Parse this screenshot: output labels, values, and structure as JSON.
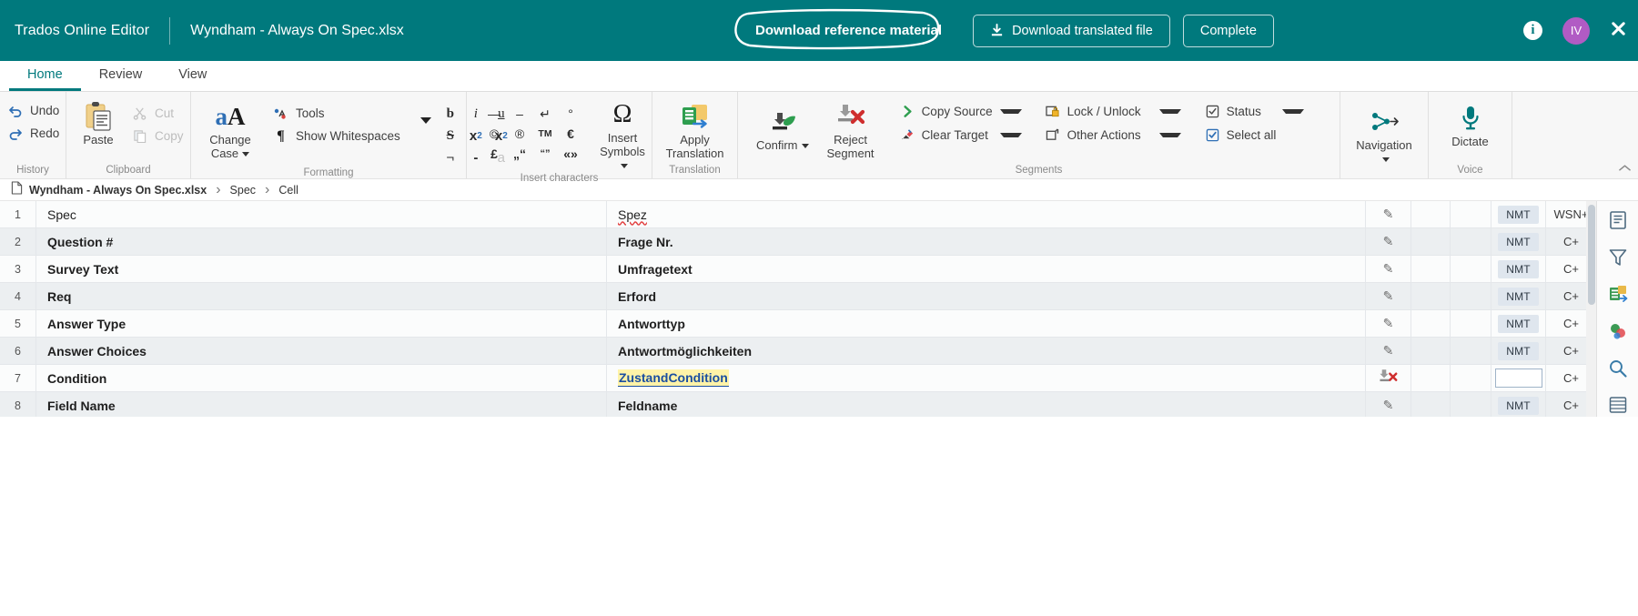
{
  "colors": {
    "brand": "#00797d",
    "accent_purple": "#b15bc4",
    "link_blue": "#1b4fa0",
    "highlight": "#fff3a8"
  },
  "topbar": {
    "brand": "Trados Online Editor",
    "document_name": "Wyndham - Always On Spec.xlsx",
    "download_reference_label": "Download reference material",
    "download_translated_label": "Download translated file",
    "complete_label": "Complete",
    "info_glyph": "i",
    "avatar_initials": "IV",
    "close_glyph": "✖"
  },
  "tabs": [
    {
      "label": "Home",
      "active": true
    },
    {
      "label": "Review",
      "active": false
    },
    {
      "label": "View",
      "active": false
    }
  ],
  "ribbon": {
    "history": {
      "label": "History",
      "undo": "Undo",
      "redo": "Redo"
    },
    "clipboard": {
      "label": "Clipboard",
      "paste": "Paste",
      "cut": "Cut",
      "copy": "Copy"
    },
    "formatting": {
      "label": "Formatting",
      "change_case": "Change Case",
      "tools": "Tools",
      "show_whitespaces": "Show Whitespaces",
      "change_case_glyph": "aA",
      "buttons": [
        "b",
        "i",
        "u",
        "S",
        "x₂",
        "x²",
        "¬",
        "-",
        "a"
      ]
    },
    "insert_characters": {
      "label": "Insert characters",
      "chars": [
        "—",
        "–",
        "↵",
        "°",
        "©",
        "®",
        "TM",
        "€",
        "£",
        "„“",
        "“”",
        "«»"
      ],
      "insert_symbols": "Insert Symbols",
      "omega": "Ω"
    },
    "translation": {
      "label": "Translation",
      "apply_translation": "Apply Translation"
    },
    "segments": {
      "label": "Segments",
      "confirm": "Confirm",
      "reject_segment": "Reject Segment",
      "copy_source": "Copy Source",
      "clear_target": "Clear Target",
      "lock_unlock": "Lock / Unlock",
      "other_actions": "Other Actions",
      "status": "Status",
      "select_all": "Select all"
    },
    "voice": {
      "label": "Voice",
      "dictate": "Dictate"
    }
  },
  "breadcrumb": {
    "file": "Wyndham - Always On Spec.xlsx",
    "sheet": "Spec",
    "cell": "Cell",
    "separator": "›"
  },
  "grid": {
    "rows": [
      {
        "num": "1",
        "source": "Spec",
        "target": "Spez",
        "target_spell_error": true,
        "bold": false,
        "status_icon": "pencil",
        "nmt": "NMT",
        "mt": "WSN+",
        "shade": "white"
      },
      {
        "num": "2",
        "source": "Question #",
        "target": "Frage Nr.",
        "bold": true,
        "status_icon": "pencil",
        "nmt": "NMT",
        "mt": "C+",
        "shade": "alt"
      },
      {
        "num": "3",
        "source": "Survey Text",
        "target": "Umfragetext",
        "bold": true,
        "status_icon": "pencil",
        "nmt": "NMT",
        "mt": "C+",
        "shade": "white"
      },
      {
        "num": "4",
        "source": "Req",
        "target": "Erford",
        "bold": true,
        "status_icon": "pencil",
        "nmt": "NMT",
        "mt": "C+",
        "shade": "alt"
      },
      {
        "num": "5",
        "source": "Answer Type",
        "target": "Antworttyp",
        "bold": true,
        "status_icon": "pencil",
        "nmt": "NMT",
        "mt": "C+",
        "shade": "white"
      },
      {
        "num": "6",
        "source": "Answer Choices",
        "target": "Antwortmöglichkeiten",
        "bold": true,
        "status_icon": "pencil",
        "nmt": "NMT",
        "mt": "C+",
        "shade": "alt"
      },
      {
        "num": "7",
        "source": "Condition",
        "target": "ZustandCondition",
        "bold": true,
        "selected": true,
        "status_icon": "reject",
        "nmt": "",
        "mt": "C+",
        "shade": "white"
      },
      {
        "num": "8",
        "source": "Field Name",
        "target": "Feldname",
        "bold": true,
        "status_icon": "pencil",
        "nmt": "NMT",
        "mt": "C+",
        "shade": "alt"
      }
    ]
  },
  "right_sidebar": {
    "items": [
      {
        "name": "document-panel-icon",
        "glyph": "☰"
      },
      {
        "name": "filter-icon",
        "glyph": "▼"
      },
      {
        "name": "termbase-icon",
        "glyph": "▤"
      },
      {
        "name": "concordance-icon",
        "glyph": "◑"
      },
      {
        "name": "search-icon",
        "glyph": "⚲"
      },
      {
        "name": "comments-icon",
        "glyph": "≣"
      }
    ]
  }
}
